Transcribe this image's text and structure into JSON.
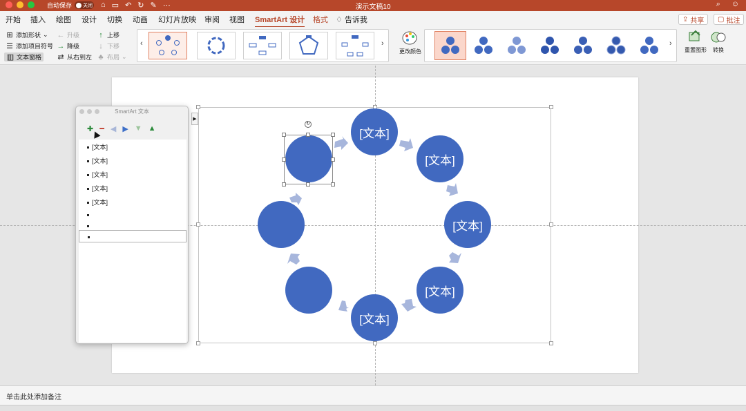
{
  "window": {
    "title": "演示文稿10",
    "autosave_label": "自动保存",
    "autosave_state": "关闭"
  },
  "tabs": [
    {
      "label": "开始"
    },
    {
      "label": "插入"
    },
    {
      "label": "绘图"
    },
    {
      "label": "设计"
    },
    {
      "label": "切换"
    },
    {
      "label": "动画"
    },
    {
      "label": "幻灯片放映"
    },
    {
      "label": "审阅"
    },
    {
      "label": "视图"
    },
    {
      "label": "SmartArt 设计"
    },
    {
      "label": "格式"
    },
    {
      "label": "告诉我"
    }
  ],
  "active_tab": "SmartArt 设计",
  "share_label": "共享",
  "comment_label": "批注",
  "ribbon": {
    "add_shape": "添加形状",
    "add_bullet": "添加项目符号",
    "text_pane": "文本窗格",
    "promote": "升级",
    "demote": "降级",
    "right_to_left": "从右到左",
    "move_up": "上移",
    "move_down": "下移",
    "layout": "布局",
    "change_colors": "更改颜色",
    "reset_graphic": "重置图形",
    "convert": "转换"
  },
  "text_pane": {
    "title": "SmartArt 文本",
    "items": [
      "[文本]",
      "[文本]",
      "[文本]",
      "[文本]",
      "[文本]",
      "",
      "",
      ""
    ]
  },
  "diagram": {
    "nodes": [
      "[文本]",
      "[文本]",
      "[文本]",
      "[文本]",
      "[文本]",
      "",
      "",
      ""
    ]
  },
  "notes_placeholder": "单击此处添加备注",
  "colors": {
    "accent": "#b7472a",
    "node": "#4169c0",
    "arrow": "#a7b6dc"
  }
}
